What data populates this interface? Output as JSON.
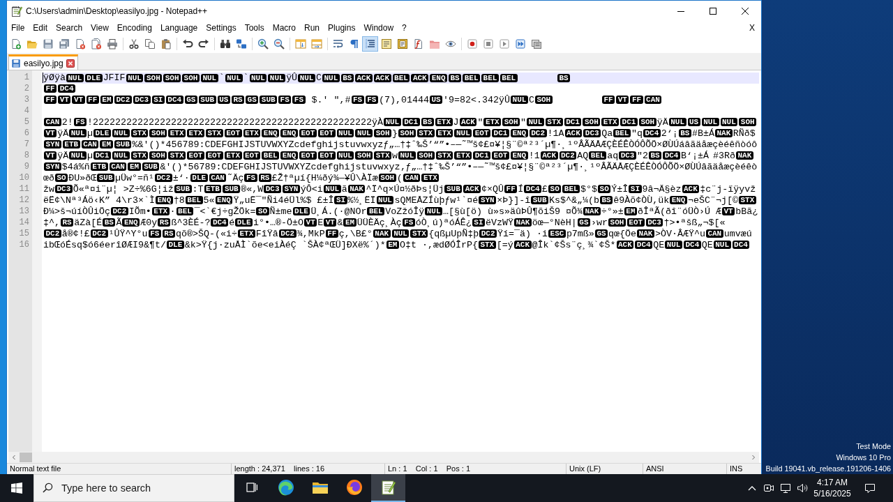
{
  "window": {
    "title": "C:\\Users\\admin\\Desktop\\easilyo.jpg - Notepad++"
  },
  "menu": {
    "items": [
      "File",
      "Edit",
      "Search",
      "View",
      "Encoding",
      "Language",
      "Settings",
      "Tools",
      "Macro",
      "Run",
      "Plugins",
      "Window",
      "?"
    ],
    "close_label": "X"
  },
  "toolbar": {
    "groups": [
      {
        "buttons": [
          {
            "kind": "new",
            "on": false
          },
          {
            "kind": "open",
            "on": false
          },
          {
            "kind": "save",
            "on": false
          },
          {
            "kind": "saveall",
            "on": false
          },
          {
            "kind": "close",
            "on": false
          },
          {
            "kind": "closeall",
            "on": false
          },
          {
            "kind": "print",
            "on": false
          }
        ]
      },
      {
        "buttons": [
          {
            "kind": "cut",
            "on": false
          },
          {
            "kind": "copy",
            "on": false
          },
          {
            "kind": "paste",
            "on": false
          }
        ]
      },
      {
        "buttons": [
          {
            "kind": "undo",
            "on": false
          },
          {
            "kind": "redo",
            "on": false
          }
        ]
      },
      {
        "buttons": [
          {
            "kind": "find",
            "on": false
          },
          {
            "kind": "replace",
            "on": false
          }
        ]
      },
      {
        "buttons": [
          {
            "kind": "zoomin",
            "on": false
          },
          {
            "kind": "zoomout",
            "on": false
          }
        ]
      },
      {
        "buttons": [
          {
            "kind": "syncv",
            "on": false
          },
          {
            "kind": "synch",
            "on": false
          }
        ]
      },
      {
        "buttons": [
          {
            "kind": "wrap",
            "on": false
          },
          {
            "kind": "allchars",
            "on": false
          },
          {
            "kind": "indent",
            "on": true
          },
          {
            "kind": "udl",
            "on": false
          },
          {
            "kind": "docmap",
            "on": false
          },
          {
            "kind": "funclist",
            "on": false
          },
          {
            "kind": "folderws",
            "on": false
          },
          {
            "kind": "monitor",
            "on": false
          }
        ]
      },
      {
        "buttons": [
          {
            "kind": "record",
            "on": false
          },
          {
            "kind": "stop",
            "on": false
          },
          {
            "kind": "play",
            "on": false
          },
          {
            "kind": "playmulti",
            "on": false
          },
          {
            "kind": "savemacro",
            "on": false
          }
        ]
      }
    ]
  },
  "tabs": [
    {
      "label": "easilyo.jpg",
      "selected": true
    }
  ],
  "editor": {
    "lines": [
      {
        "number": "1",
        "current": true,
        "segments": [
          {
            "kind": "text",
            "text": "ÿØÿà"
          },
          {
            "kind": "ctrl",
            "text": "NUL"
          },
          {
            "kind": "ctrl",
            "text": "DLE"
          },
          {
            "kind": "text",
            "text": "JFIF"
          },
          {
            "kind": "ctrl",
            "text": "NUL"
          },
          {
            "kind": "ctrl",
            "text": "SOH"
          },
          {
            "kind": "ctrl",
            "text": "SOH"
          },
          {
            "kind": "ctrl",
            "text": "SOH"
          },
          {
            "kind": "ctrl",
            "text": "NUL"
          },
          {
            "kind": "text",
            "text": "`"
          },
          {
            "kind": "ctrl",
            "text": "NUL"
          },
          {
            "kind": "text",
            "text": "`"
          },
          {
            "kind": "ctrl",
            "text": "NUL"
          },
          {
            "kind": "ctrl",
            "text": "NUL"
          },
          {
            "kind": "text",
            "text": "ÿÛ"
          },
          {
            "kind": "ctrl",
            "text": "NUL"
          },
          {
            "kind": "text",
            "text": "C"
          },
          {
            "kind": "ctrl",
            "text": "NUL"
          },
          {
            "kind": "ctrl",
            "text": "BS"
          },
          {
            "kind": "ctrl",
            "text": "ACK"
          },
          {
            "kind": "ctrl",
            "text": "ACK"
          },
          {
            "kind": "ctrl",
            "text": "BEL"
          },
          {
            "kind": "ctrl",
            "text": "ACK"
          },
          {
            "kind": "ctrl",
            "text": "ENQ"
          },
          {
            "kind": "ctrl",
            "text": "BS"
          },
          {
            "kind": "ctrl",
            "text": "BEL"
          },
          {
            "kind": "ctrl",
            "text": "BEL"
          },
          {
            "kind": "ctrl",
            "text": "BEL"
          },
          {
            "kind": "tab"
          },
          {
            "kind": "tab"
          },
          {
            "kind": "ctrl",
            "text": "BS"
          }
        ]
      },
      {
        "number": "2",
        "current": false,
        "segments": [
          {
            "kind": "ctrl",
            "text": "FF"
          },
          {
            "kind": "ctrl",
            "text": "DC4"
          }
        ]
      },
      {
        "number": "3",
        "current": false,
        "segments": [
          {
            "kind": "ctrl",
            "text": "FF"
          },
          {
            "kind": "ctrl",
            "text": "VT"
          },
          {
            "kind": "ctrl",
            "text": "VT"
          },
          {
            "kind": "ctrl",
            "text": "FF"
          },
          {
            "kind": "ctrl",
            "text": "EM"
          },
          {
            "kind": "ctrl",
            "text": "DC2"
          },
          {
            "kind": "ctrl",
            "text": "DC3"
          },
          {
            "kind": "ctrl",
            "text": "SI"
          },
          {
            "kind": "ctrl",
            "text": "DC4"
          },
          {
            "kind": "ctrl",
            "text": "GS"
          },
          {
            "kind": "ctrl",
            "text": "SUB"
          },
          {
            "kind": "ctrl",
            "text": "US"
          },
          {
            "kind": "ctrl",
            "text": "RS"
          },
          {
            "kind": "ctrl",
            "text": "GS"
          },
          {
            "kind": "ctrl",
            "text": "SUB"
          },
          {
            "kind": "ctrl",
            "text": "FS"
          },
          {
            "kind": "ctrl",
            "text": "FS"
          },
          {
            "kind": "text",
            "text": " $.' \",#"
          },
          {
            "kind": "ctrl",
            "text": "FS"
          },
          {
            "kind": "ctrl",
            "text": "FS"
          },
          {
            "kind": "text",
            "text": "(7),01444"
          },
          {
            "kind": "ctrl",
            "text": "US"
          },
          {
            "kind": "text",
            "text": "'9=82<.342ÿÛ"
          },
          {
            "kind": "ctrl",
            "text": "NUL"
          },
          {
            "kind": "text",
            "text": "C"
          },
          {
            "kind": "ctrl",
            "text": "SOH"
          },
          {
            "kind": "tab"
          },
          {
            "kind": "tab"
          },
          {
            "kind": "tab"
          },
          {
            "kind": "ctrl",
            "text": "FF"
          },
          {
            "kind": "ctrl",
            "text": "VT"
          },
          {
            "kind": "ctrl",
            "text": "FF"
          },
          {
            "kind": "ctrl",
            "text": "CAN"
          }
        ]
      },
      {
        "number": "4",
        "current": false
      },
      {
        "number": "5",
        "current": false,
        "segments": [
          {
            "kind": "ctrl",
            "text": "CAN"
          },
          {
            "kind": "text",
            "text": "2!"
          },
          {
            "kind": "ctrl",
            "text": "FS"
          },
          {
            "kind": "text",
            "text": "!22222222222222222222222222222222222222222222222222ÿÀ"
          },
          {
            "kind": "ctrl",
            "text": "NUL"
          },
          {
            "kind": "ctrl",
            "text": "DC1"
          },
          {
            "kind": "ctrl",
            "text": "BS"
          },
          {
            "kind": "ctrl",
            "text": "ETX"
          },
          {
            "kind": "text",
            "text": "J"
          },
          {
            "kind": "ctrl",
            "text": "ACK"
          },
          {
            "kind": "text",
            "text": "\""
          },
          {
            "kind": "ctrl",
            "text": "ETX"
          },
          {
            "kind": "ctrl",
            "text": "SOH"
          },
          {
            "kind": "text",
            "text": "\""
          },
          {
            "kind": "ctrl",
            "text": "NUL"
          },
          {
            "kind": "ctrl",
            "text": "STX"
          },
          {
            "kind": "ctrl",
            "text": "DC1"
          },
          {
            "kind": "ctrl",
            "text": "SOH"
          },
          {
            "kind": "ctrl",
            "text": "ETX"
          },
          {
            "kind": "ctrl",
            "text": "DC1"
          },
          {
            "kind": "ctrl",
            "text": "SOH"
          },
          {
            "kind": "text",
            "text": "ÿÄ"
          },
          {
            "kind": "ctrl",
            "text": "NUL"
          },
          {
            "kind": "ctrl",
            "text": "US"
          },
          {
            "kind": "ctrl",
            "text": "NUL"
          },
          {
            "kind": "ctrl",
            "text": "NUL"
          },
          {
            "kind": "ctrl",
            "text": "SOH"
          }
        ]
      },
      {
        "number": "6",
        "current": false,
        "segments": [
          {
            "kind": "ctrl",
            "text": "VT"
          },
          {
            "kind": "text",
            "text": "ÿÄ"
          },
          {
            "kind": "ctrl",
            "text": "NUL"
          },
          {
            "kind": "text",
            "text": "µ"
          },
          {
            "kind": "ctrl",
            "text": "DLE"
          },
          {
            "kind": "ctrl",
            "text": "NUL"
          },
          {
            "kind": "ctrl",
            "text": "STX"
          },
          {
            "kind": "ctrl",
            "text": "SOH"
          },
          {
            "kind": "ctrl",
            "text": "ETX"
          },
          {
            "kind": "ctrl",
            "text": "ETX"
          },
          {
            "kind": "ctrl",
            "text": "STX"
          },
          {
            "kind": "ctrl",
            "text": "EOT"
          },
          {
            "kind": "ctrl",
            "text": "ETX"
          },
          {
            "kind": "ctrl",
            "text": "ENQ"
          },
          {
            "kind": "ctrl",
            "text": "ENQ"
          },
          {
            "kind": "ctrl",
            "text": "EOT"
          },
          {
            "kind": "ctrl",
            "text": "EOT"
          },
          {
            "kind": "ctrl",
            "text": "NUL"
          },
          {
            "kind": "ctrl",
            "text": "NUL"
          },
          {
            "kind": "ctrl",
            "text": "SOH"
          },
          {
            "kind": "text",
            "text": "}"
          },
          {
            "kind": "ctrl",
            "text": "SOH"
          },
          {
            "kind": "ctrl",
            "text": "STX"
          },
          {
            "kind": "ctrl",
            "text": "ETX"
          },
          {
            "kind": "ctrl",
            "text": "NUL"
          },
          {
            "kind": "ctrl",
            "text": "EOT"
          },
          {
            "kind": "ctrl",
            "text": "DC1"
          },
          {
            "kind": "ctrl",
            "text": "ENQ"
          },
          {
            "kind": "ctrl",
            "text": "DC2"
          },
          {
            "kind": "text",
            "text": "!1A"
          },
          {
            "kind": "ctrl",
            "text": "ACK"
          },
          {
            "kind": "ctrl",
            "text": "DC3"
          },
          {
            "kind": "text",
            "text": "Qa"
          },
          {
            "kind": "ctrl",
            "text": "BEL"
          },
          {
            "kind": "text",
            "text": "\"q"
          },
          {
            "kind": "ctrl",
            "text": "DC4"
          },
          {
            "kind": "text",
            "text": "2‘¡"
          },
          {
            "kind": "ctrl",
            "text": "BS"
          },
          {
            "kind": "text",
            "text": "#B±Á"
          },
          {
            "kind": "ctrl",
            "text": "NAK"
          },
          {
            "kind": "text",
            "text": "RÑð$"
          }
        ]
      },
      {
        "number": "7",
        "current": false,
        "segments": [
          {
            "kind": "ctrl",
            "text": "SYN"
          },
          {
            "kind": "ctrl",
            "text": "ETB"
          },
          {
            "kind": "ctrl",
            "text": "CAN"
          },
          {
            "kind": "ctrl",
            "text": "EM"
          },
          {
            "kind": "ctrl",
            "text": "SUB"
          },
          {
            "kind": "text",
            "text": "%&'()*456789:CDEFGHIJSTUVWXYZcdefghijstuvwxyzƒ„…†‡ˆ‰Š’“”•–—˜™š¢£¤¥¦§¨©ª²³´µ¶·¸¹ºÂÃÄÅÆÇÈÉÊÒÓÔÕÖ×ØÙÚáâãäåæçèéêñòóô"
          }
        ]
      },
      {
        "number": "8",
        "current": false,
        "segments": [
          {
            "kind": "ctrl",
            "text": "VT"
          },
          {
            "kind": "text",
            "text": "ÿÄ"
          },
          {
            "kind": "ctrl",
            "text": "NUL"
          },
          {
            "kind": "text",
            "text": "µ"
          },
          {
            "kind": "ctrl",
            "text": "DC1"
          },
          {
            "kind": "ctrl",
            "text": "NUL"
          },
          {
            "kind": "ctrl",
            "text": "STX"
          },
          {
            "kind": "ctrl",
            "text": "SOH"
          },
          {
            "kind": "ctrl",
            "text": "STX"
          },
          {
            "kind": "ctrl",
            "text": "EOT"
          },
          {
            "kind": "ctrl",
            "text": "EOT"
          },
          {
            "kind": "ctrl",
            "text": "ETX"
          },
          {
            "kind": "ctrl",
            "text": "EOT"
          },
          {
            "kind": "ctrl",
            "text": "BEL"
          },
          {
            "kind": "ctrl",
            "text": "ENQ"
          },
          {
            "kind": "ctrl",
            "text": "EOT"
          },
          {
            "kind": "ctrl",
            "text": "EOT"
          },
          {
            "kind": "ctrl",
            "text": "NUL"
          },
          {
            "kind": "ctrl",
            "text": "SOH"
          },
          {
            "kind": "ctrl",
            "text": "STX"
          },
          {
            "kind": "text",
            "text": "w"
          },
          {
            "kind": "ctrl",
            "text": "NUL"
          },
          {
            "kind": "ctrl",
            "text": "SOH"
          },
          {
            "kind": "ctrl",
            "text": "STX"
          },
          {
            "kind": "ctrl",
            "text": "ETX"
          },
          {
            "kind": "ctrl",
            "text": "DC1"
          },
          {
            "kind": "ctrl",
            "text": "EOT"
          },
          {
            "kind": "ctrl",
            "text": "ENQ"
          },
          {
            "kind": "text",
            "text": "!1"
          },
          {
            "kind": "ctrl",
            "text": "ACK"
          },
          {
            "kind": "ctrl",
            "text": "DC2"
          },
          {
            "kind": "text",
            "text": "AQ"
          },
          {
            "kind": "ctrl",
            "text": "BEL"
          },
          {
            "kind": "text",
            "text": "aq"
          },
          {
            "kind": "ctrl",
            "text": "DC3"
          },
          {
            "kind": "text",
            "text": "\"2"
          },
          {
            "kind": "ctrl",
            "text": "BS"
          },
          {
            "kind": "ctrl",
            "text": "DC4"
          },
          {
            "kind": "text",
            "text": "B‘¡±Á\t#3Rð"
          },
          {
            "kind": "ctrl",
            "text": "NAK"
          }
        ]
      },
      {
        "number": "9",
        "current": false,
        "segments": [
          {
            "kind": "ctrl",
            "text": "SYN"
          },
          {
            "kind": "text",
            "text": "$4á%ñ"
          },
          {
            "kind": "ctrl",
            "text": "ETB"
          },
          {
            "kind": "ctrl",
            "text": "CAN"
          },
          {
            "kind": "ctrl",
            "text": "EM"
          },
          {
            "kind": "ctrl",
            "text": "SUB"
          },
          {
            "kind": "text",
            "text": "&'()*56789:CDEFGHIJSTUVWXYZcdefghijstuvwxyz‚ƒ„…†‡ˆ‰Š’“”•–—˜™š¢£¤¥¦§¨©ª²³´µ¶·¸¹ºÂÃÄÅÆÇÈÉÊÒÓÔÕÖ×ØÙÚâãäåæçèéêò"
          }
        ]
      },
      {
        "number": "10",
        "current": false,
        "segments": [
          {
            "kind": "text",
            "text": "œð"
          },
          {
            "kind": "ctrl",
            "text": "SO"
          },
          {
            "kind": "text",
            "text": "ÐU»ðŒ"
          },
          {
            "kind": "ctrl",
            "text": "SUB"
          },
          {
            "kind": "text",
            "text": "µÜw°=ñ¹"
          },
          {
            "kind": "ctrl",
            "text": "DC2"
          },
          {
            "kind": "text",
            "text": "±‘·"
          },
          {
            "kind": "ctrl",
            "text": "DLE"
          },
          {
            "kind": "ctrl",
            "text": "CAN"
          },
          {
            "kind": "text",
            "text": "˜Äç"
          },
          {
            "kind": "ctrl",
            "text": "FS"
          },
          {
            "kind": "ctrl",
            "text": "RS"
          },
          {
            "kind": "text",
            "text": "£Ž†ªµí{H¼ðý¾—¥Û\\ÀÏæ"
          },
          {
            "kind": "ctrl",
            "text": "SOH"
          },
          {
            "kind": "text",
            "text": "("
          },
          {
            "kind": "ctrl",
            "text": "CAN"
          },
          {
            "kind": "ctrl",
            "text": "ETX"
          }
        ]
      },
      {
        "number": "11",
        "current": false,
        "segments": [
          {
            "kind": "text",
            "text": "žw"
          },
          {
            "kind": "ctrl",
            "text": "DC3"
          },
          {
            "kind": "text",
            "text": "Õ«ª¤i¨µ¦ >Z÷%6G¦iž"
          },
          {
            "kind": "ctrl",
            "text": "SUB"
          },
          {
            "kind": "text",
            "text": ":T"
          },
          {
            "kind": "ctrl",
            "text": "ETB"
          },
          {
            "kind": "ctrl",
            "text": "SUB"
          },
          {
            "kind": "text",
            "text": "®«,W"
          },
          {
            "kind": "ctrl",
            "text": "DC3"
          },
          {
            "kind": "ctrl",
            "text": "SYN"
          },
          {
            "kind": "text",
            "text": "ýÔ<i"
          },
          {
            "kind": "ctrl",
            "text": "NUL"
          },
          {
            "kind": "text",
            "text": "ã"
          },
          {
            "kind": "ctrl",
            "text": "NAK"
          },
          {
            "kind": "text",
            "text": "^Ï^q×Ú¤½ðÞs¦Üj"
          },
          {
            "kind": "ctrl",
            "text": "SUB"
          },
          {
            "kind": "ctrl",
            "text": "ACK"
          },
          {
            "kind": "text",
            "text": "¢×QÛ"
          },
          {
            "kind": "ctrl",
            "text": "FF"
          },
          {
            "kind": "text",
            "text": "Í"
          },
          {
            "kind": "ctrl",
            "text": "DC4"
          },
          {
            "kind": "text",
            "text": "£"
          },
          {
            "kind": "ctrl",
            "text": "SO"
          },
          {
            "kind": "ctrl",
            "text": "BEL"
          },
          {
            "kind": "text",
            "text": "$°$"
          },
          {
            "kind": "ctrl",
            "text": "SO"
          },
          {
            "kind": "text",
            "text": "Ý±Î"
          },
          {
            "kind": "ctrl",
            "text": "SI"
          },
          {
            "kind": "text",
            "text": "9â¬Ä§èz"
          },
          {
            "kind": "ctrl",
            "text": "ACK"
          },
          {
            "kind": "text",
            "text": "‡c¨j-ïÿyvž"
          }
        ]
      },
      {
        "number": "12",
        "current": false,
        "segments": [
          {
            "kind": "text",
            "text": "ëË¢\\Nª³Áö‹K” 4\\r3×`Ì"
          },
          {
            "kind": "ctrl",
            "text": "ENQ"
          },
          {
            "kind": "text",
            "text": "†8"
          },
          {
            "kind": "ctrl",
            "text": "BEL"
          },
          {
            "kind": "text",
            "text": "5«"
          },
          {
            "kind": "ctrl",
            "text": "ENQ"
          },
          {
            "kind": "text",
            "text": "Ÿ„uË¯\"Ñi4éÜl%$ £±Î"
          },
          {
            "kind": "ctrl",
            "text": "SI"
          },
          {
            "kind": "text",
            "text": "%½¸ËÏ"
          },
          {
            "kind": "ctrl",
            "text": "NUL"
          },
          {
            "kind": "text",
            "text": "sQMEÅZÍùþƒw¹`¤é"
          },
          {
            "kind": "ctrl",
            "text": "SYN"
          },
          {
            "kind": "text",
            "text": "×Þ}]-î"
          },
          {
            "kind": "ctrl",
            "text": "SUB"
          },
          {
            "kind": "text",
            "text": "Ks$^&„¼(b"
          },
          {
            "kind": "ctrl",
            "text": "BS"
          },
          {
            "kind": "text",
            "text": "ê9Àõ¢ÒÙ,ük"
          },
          {
            "kind": "ctrl",
            "text": "ENQ"
          },
          {
            "kind": "text",
            "text": "¬eŠC¨¬j[©"
          },
          {
            "kind": "ctrl",
            "text": "STX"
          }
        ]
      },
      {
        "number": "13",
        "current": false,
        "segments": [
          {
            "kind": "text",
            "text": "Ð¼>š¬úíÒÛiÖç"
          },
          {
            "kind": "ctrl",
            "text": "DC2"
          },
          {
            "kind": "text",
            "text": "IÕm•"
          },
          {
            "kind": "ctrl",
            "text": "ETX"
          },
          {
            "kind": "text",
            "text": "·"
          },
          {
            "kind": "ctrl",
            "text": "BEL"
          },
          {
            "kind": "text",
            "text": "¯<`€j÷gŽÖk="
          },
          {
            "kind": "ctrl",
            "text": "SO"
          },
          {
            "kind": "text",
            "text": "Ñ±me"
          },
          {
            "kind": "ctrl",
            "text": "DLE"
          },
          {
            "kind": "text",
            "text": "Ü¸Á.(·@NOr"
          },
          {
            "kind": "ctrl",
            "text": "BEL"
          },
          {
            "kind": "text",
            "text": "VoZžóÎÿ"
          },
          {
            "kind": "ctrl",
            "text": "NUL"
          },
          {
            "kind": "text",
            "text": "…[§ù[ö) ù»s»äûÞÛ¶õiŠ9 ¤Õ¾"
          },
          {
            "kind": "ctrl",
            "text": "NAK"
          },
          {
            "kind": "text",
            "text": "÷°»±"
          },
          {
            "kind": "ctrl",
            "text": "EM"
          },
          {
            "kind": "text",
            "text": "ðÎªÃ(ðî¨óÜÒ›Ú Æ"
          },
          {
            "kind": "ctrl",
            "text": "VT"
          },
          {
            "kind": "text",
            "text": "bBã¿"
          }
        ]
      },
      {
        "number": "14",
        "current": false,
        "segments": [
          {
            "kind": "text",
            "text": "‡^,"
          },
          {
            "kind": "ctrl",
            "text": "RS"
          },
          {
            "kind": "text",
            "text": "äZà[É"
          },
          {
            "kind": "ctrl",
            "text": "BS"
          },
          {
            "kind": "text",
            "text": "Ã"
          },
          {
            "kind": "ctrl",
            "text": "ENQ"
          },
          {
            "kind": "text",
            "text": "Æ0y"
          },
          {
            "kind": "ctrl",
            "text": "RS"
          },
          {
            "kind": "text",
            "text": "ß^3ÈÉ-?"
          },
          {
            "kind": "ctrl",
            "text": "DC4"
          },
          {
            "kind": "text",
            "text": "é"
          },
          {
            "kind": "ctrl",
            "text": "DLE"
          },
          {
            "kind": "text",
            "text": "i°•…®-Ö±O"
          },
          {
            "kind": "ctrl",
            "text": "VT"
          },
          {
            "kind": "text",
            "text": "E"
          },
          {
            "kind": "ctrl",
            "text": "VT"
          },
          {
            "kind": "text",
            "text": "&"
          },
          {
            "kind": "ctrl",
            "text": "EM"
          },
          {
            "kind": "text",
            "text": "ÜÜÈÄç¸Àç"
          },
          {
            "kind": "ctrl",
            "text": "FS"
          },
          {
            "kind": "text",
            "text": "óÒ¸ú)ªóÁÊ¿"
          },
          {
            "kind": "ctrl",
            "text": "SI"
          },
          {
            "kind": "text",
            "text": "ëVzWŸ"
          },
          {
            "kind": "ctrl",
            "text": "NAK"
          },
          {
            "kind": "text",
            "text": "öœ—°NèH|"
          },
          {
            "kind": "ctrl",
            "text": "GS"
          },
          {
            "kind": "text",
            "text": "›wr"
          },
          {
            "kind": "ctrl",
            "text": "SOH"
          },
          {
            "kind": "ctrl",
            "text": "EOT"
          },
          {
            "kind": "ctrl",
            "text": "DC3"
          },
          {
            "kind": "text",
            "text": "†>•ªšß„¬$[«"
          }
        ]
      },
      {
        "number": "15",
        "current": false,
        "segments": [
          {
            "kind": "ctrl",
            "text": "DC2"
          },
          {
            "kind": "text",
            "text": "å®¢!£"
          },
          {
            "kind": "ctrl",
            "text": "DC2"
          },
          {
            "kind": "text",
            "text": "¹ÛŸ^Y°u"
          },
          {
            "kind": "ctrl",
            "text": "FS"
          },
          {
            "kind": "ctrl",
            "text": "RS"
          },
          {
            "kind": "text",
            "text": "qõ®>ŠQ-(«i÷"
          },
          {
            "kind": "ctrl",
            "text": "ETX"
          },
          {
            "kind": "text",
            "text": "FîŸâ"
          },
          {
            "kind": "ctrl",
            "text": "DC2"
          },
          {
            "kind": "text",
            "text": "¾,MkP"
          },
          {
            "kind": "ctrl",
            "text": "FF"
          },
          {
            "kind": "text",
            "text": "ç,\\B£°"
          },
          {
            "kind": "ctrl",
            "text": "NAK"
          },
          {
            "kind": "ctrl",
            "text": "NUL"
          },
          {
            "kind": "ctrl",
            "text": "STX"
          },
          {
            "kind": "text",
            "text": "{qßµUpÑ‡þ"
          },
          {
            "kind": "ctrl",
            "text": "DC2"
          },
          {
            "kind": "text",
            "text": "Ÿí=¯ä) ·i"
          },
          {
            "kind": "ctrl",
            "text": "ESC"
          },
          {
            "kind": "text",
            "text": "p7mß»"
          },
          {
            "kind": "ctrl",
            "text": "GS"
          },
          {
            "kind": "text",
            "text": "qœ{Öe"
          },
          {
            "kind": "ctrl",
            "text": "NAK"
          },
          {
            "kind": "text",
            "text": ">ÒV·ÂÆŸ^u"
          },
          {
            "kind": "ctrl",
            "text": "CAN"
          },
          {
            "kind": "text",
            "text": "umvæú"
          }
        ]
      },
      {
        "number": "16",
        "current": false,
        "segments": [
          {
            "kind": "text",
            "text": "ibŒóÉsq$ó6éerîØÆI9&¶t/"
          },
          {
            "kind": "ctrl",
            "text": "DLE"
          },
          {
            "kind": "text",
            "text": "&k>Ÿ{j·zuÅÌ`õe<eiÀéÇ `ŠÀ¢ªŒÜ]ÐXë%´)*"
          },
          {
            "kind": "ctrl",
            "text": "EM"
          },
          {
            "kind": "text",
            "text": "O‡t ·,ædØÓÎrP{"
          },
          {
            "kind": "ctrl",
            "text": "STX"
          },
          {
            "kind": "text",
            "text": "[=ý"
          },
          {
            "kind": "ctrl",
            "text": "ACK"
          },
          {
            "kind": "text",
            "text": "@Îk`¢Šs¨ç¸¾`¢Š*"
          },
          {
            "kind": "ctrl",
            "text": "ACK"
          },
          {
            "kind": "ctrl",
            "text": "DC4"
          },
          {
            "kind": "text",
            "text": "QE"
          },
          {
            "kind": "ctrl",
            "text": "NUL"
          },
          {
            "kind": "ctrl",
            "text": "DC4"
          },
          {
            "kind": "text",
            "text": "QE"
          },
          {
            "kind": "ctrl",
            "text": "NUL"
          },
          {
            "kind": "ctrl",
            "text": "DC4"
          }
        ]
      }
    ]
  },
  "status_bar": [
    "Normal text file",
    "length : 24,371    lines : 16",
    "Ln : 1    Col : 1    Pos : 1",
    "Unix (LF)",
    "ANSI",
    "INS"
  ],
  "desktop": {
    "notice": [
      "Test Mode",
      "Windows 10 Pro",
      "Build 19041.vb_release.191206-1406"
    ]
  },
  "taskbar": {
    "search": {
      "placeholder": "Type here to search"
    },
    "apps": [
      {
        "kind": "taskview",
        "selected": false
      },
      {
        "kind": "edge",
        "selected": false
      },
      {
        "kind": "explorer",
        "selected": false
      },
      {
        "kind": "firefox",
        "selected": false
      },
      {
        "kind": "notepad",
        "selected": true
      }
    ],
    "tray": [
      {
        "kind": "chevron"
      },
      {
        "kind": "meet"
      },
      {
        "kind": "network"
      },
      {
        "kind": "volume"
      }
    ],
    "clock": {
      "time": "4:17 AM",
      "date": "5/16/2025"
    }
  }
}
